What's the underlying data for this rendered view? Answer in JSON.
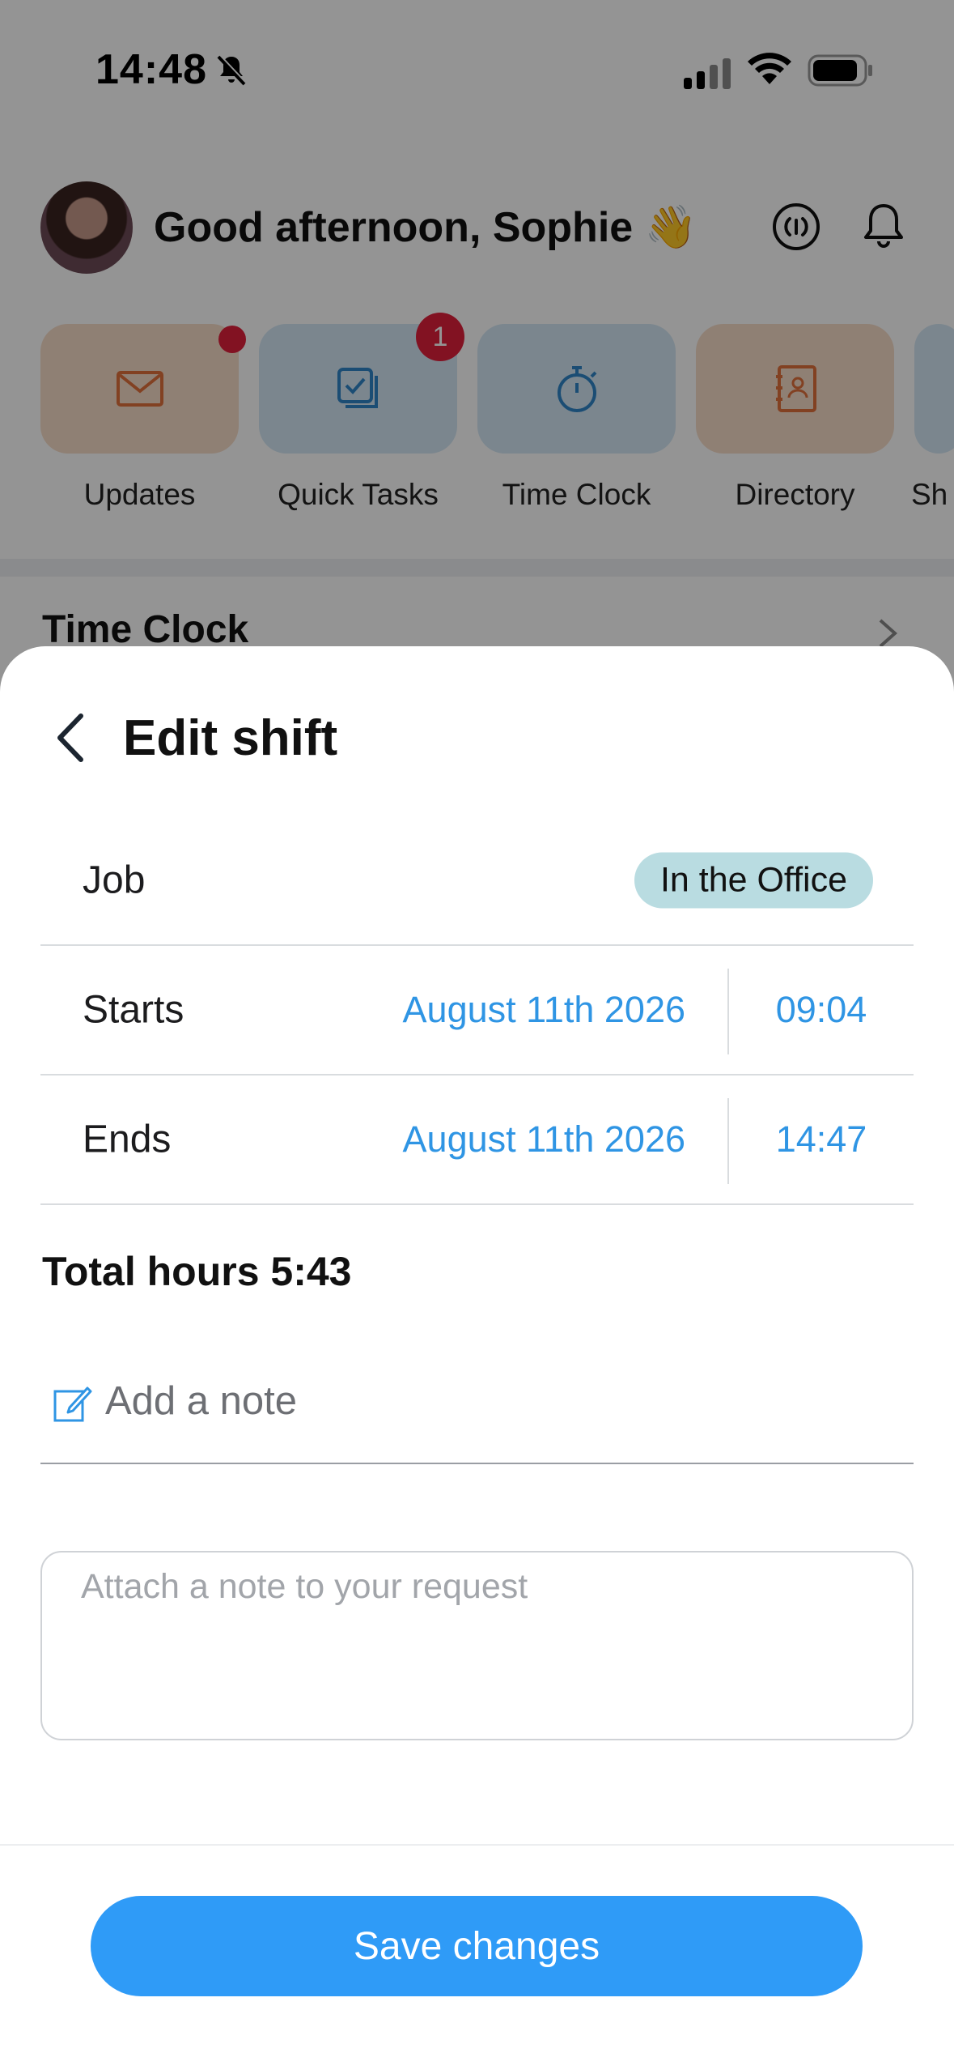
{
  "status_bar": {
    "time": "14:48"
  },
  "header": {
    "greeting": "Good afternoon, Sophie 👋"
  },
  "quick_actions": [
    {
      "label": "Updates",
      "icon": "envelope-icon",
      "tile_color": "#f7dcc9"
    },
    {
      "label": "Quick Tasks",
      "icon": "checklist-icon",
      "tile_color": "#d4e7f5",
      "badge": "1"
    },
    {
      "label": "Time Clock",
      "icon": "stopwatch-icon",
      "tile_color": "#d4e7f5"
    },
    {
      "label": "Directory",
      "icon": "contact-book-icon",
      "tile_color": "#f7dcc9"
    },
    {
      "label": "Sh"
    }
  ],
  "section": {
    "title": "Time Clock"
  },
  "sheet": {
    "title": "Edit shift",
    "job": {
      "label": "Job",
      "value": "In the Office"
    },
    "starts": {
      "label": "Starts",
      "date": "August 11th 2026",
      "time": "09:04"
    },
    "ends": {
      "label": "Ends",
      "date": "August 11th 2026",
      "time": "14:47"
    },
    "total_hours": "Total hours 5:43",
    "note": {
      "label": "Add a note",
      "placeholder": "Attach a note to your request"
    },
    "save_label": "Save changes"
  },
  "colors": {
    "accent_blue": "#2f95e4",
    "button_blue": "#2f9bf7",
    "job_pill": "#b9dce1",
    "alert_red": "#e0203c"
  }
}
